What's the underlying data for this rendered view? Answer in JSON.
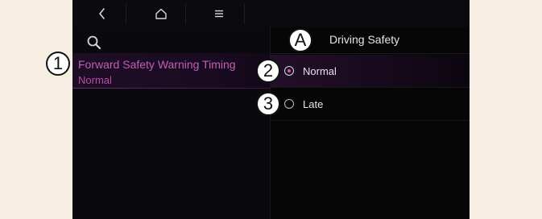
{
  "topbar": {
    "back_icon": "back-chevron-icon",
    "home_icon": "home-icon",
    "menu_icon": "menu-icon"
  },
  "left": {
    "search_icon": "search-icon",
    "list_item": {
      "title": "Forward Safety Warning Timing",
      "value": "Normal"
    }
  },
  "right": {
    "header_title": "Driving Safety",
    "options": [
      {
        "label": "Normal",
        "selected": true
      },
      {
        "label": "Late",
        "selected": false
      }
    ]
  },
  "callouts": {
    "one": "1",
    "two": "2",
    "three": "3",
    "a": "A"
  },
  "colors": {
    "accent": "#c25fb6",
    "background": "#070708",
    "page": "#f6eee3"
  }
}
